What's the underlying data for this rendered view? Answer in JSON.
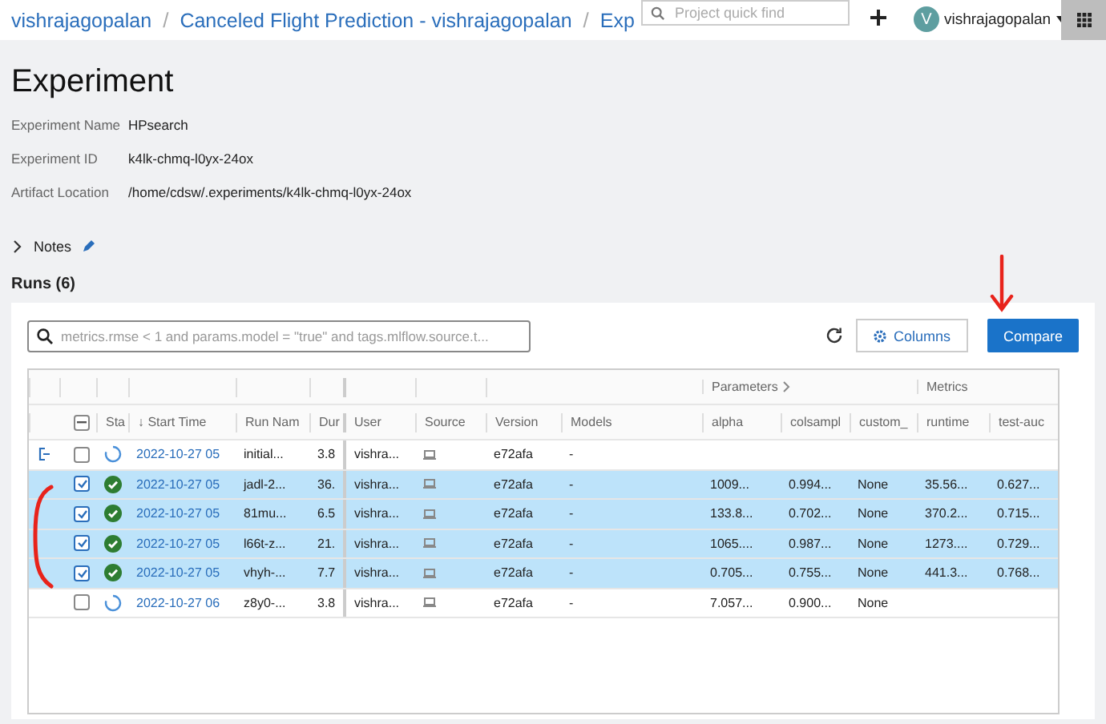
{
  "topbar": {
    "breadcrumbs": [
      "vishrajagopalan",
      "Canceled Flight Prediction - vishrajagopalan",
      "Exp"
    ],
    "separator": "/",
    "search": {
      "placeholder": "Project quick find"
    },
    "avatar": "V",
    "user": "vishrajagopalan"
  },
  "title": "Experiment",
  "details": [
    {
      "label": "Experiment Name",
      "value": "HPsearch"
    },
    {
      "label": "Experiment ID",
      "value": "k4lk-chmq-l0yx-24ox"
    },
    {
      "label": "Artifact Location",
      "value": "/home/cdsw/.experiments/k4lk-chmq-l0yx-24ox"
    }
  ],
  "notes": {
    "label": "Notes",
    "expanded": false
  },
  "runs_heading": "Runs (6)",
  "runs_toolbar": {
    "search": {
      "placeholder": "metrics.rmse < 1 and params.model = \"true\" and tags.mlflow.source.t..."
    },
    "columns_button": "Columns",
    "compare_button": "Compare"
  },
  "table": {
    "groups": [
      "Parameters",
      "Metrics"
    ],
    "select_all_indeterminate": true,
    "columns": [
      "Sta",
      "↓ Start Time",
      "Run Nam",
      "Dur",
      "User",
      "Source",
      "Version",
      "Models",
      "alpha",
      "colsampl",
      "custom_",
      "runtime",
      "test-auc"
    ],
    "rows": [
      {
        "selected": false,
        "expanded": true,
        "finished": false,
        "cells": [
          "",
          "2022-10-27 05",
          "initial...",
          "3.8",
          "vishra...",
          "",
          "e72afa",
          "-",
          "",
          "",
          "",
          "",
          ""
        ]
      },
      {
        "selected": true,
        "finished": true,
        "cells": [
          "",
          "2022-10-27 05",
          "jadl-2...",
          "36.",
          "vishra...",
          "",
          "e72afa",
          "-",
          "1009...",
          "0.994...",
          "None",
          "35.56...",
          "0.627..."
        ]
      },
      {
        "selected": true,
        "finished": true,
        "cells": [
          "",
          "2022-10-27 05",
          "81mu...",
          "6.5",
          "vishra...",
          "",
          "e72afa",
          "-",
          "133.8...",
          "0.702...",
          "None",
          "370.2...",
          "0.715..."
        ]
      },
      {
        "selected": true,
        "finished": true,
        "cells": [
          "",
          "2022-10-27 05",
          "l66t-z...",
          "21.",
          "vishra...",
          "",
          "e72afa",
          "-",
          "1065....",
          "0.987...",
          "None",
          "1273....",
          "0.729..."
        ]
      },
      {
        "selected": true,
        "finished": true,
        "cells": [
          "",
          "2022-10-27 05",
          "vhyh-...",
          "7.7",
          "vishra...",
          "",
          "e72afa",
          "-",
          "0.705...",
          "0.755...",
          "None",
          "441.3...",
          "0.768..."
        ]
      },
      {
        "selected": false,
        "finished": false,
        "cells": [
          "",
          "2022-10-27 06",
          "z8y0-...",
          "3.8",
          "vishra...",
          "",
          "e72afa",
          "-",
          "7.057...",
          "0.900...",
          "None",
          "",
          ""
        ]
      }
    ]
  }
}
